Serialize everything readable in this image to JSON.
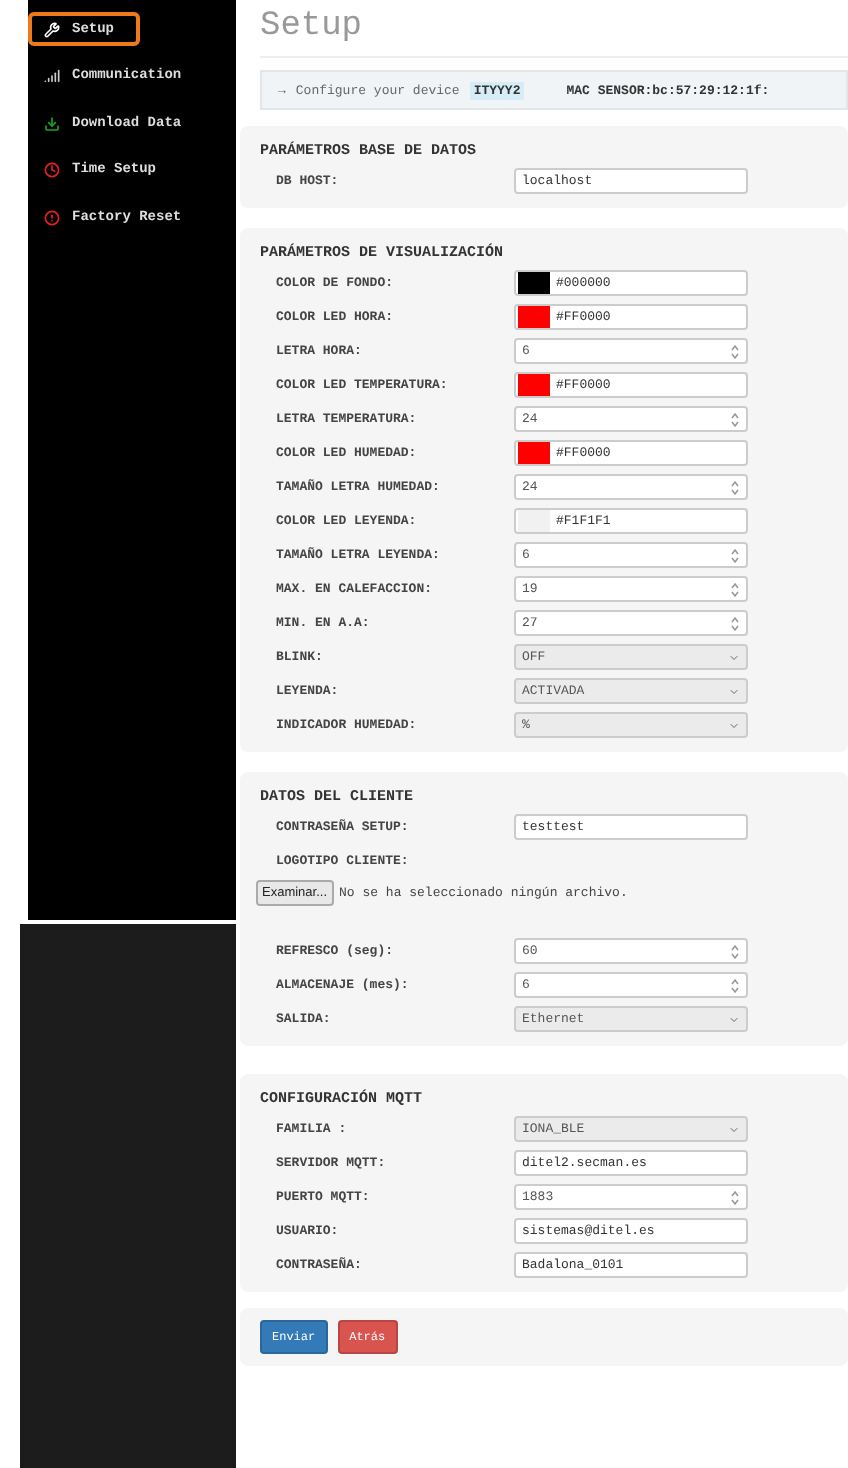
{
  "sidebar": {
    "items": [
      {
        "label": "Setup",
        "kind": "setup",
        "selected": true
      },
      {
        "label": "Communication",
        "kind": "communication",
        "selected": false
      },
      {
        "label": "Download Data",
        "kind": "download",
        "selected": false
      },
      {
        "label": "Time Setup",
        "kind": "time",
        "selected": false
      },
      {
        "label": "Factory Reset",
        "kind": "reset",
        "selected": false
      }
    ]
  },
  "page_title": "Setup",
  "info": {
    "arrow": "→",
    "text": "Configure your device",
    "device": "ITYYY2",
    "mac": "MAC SENSOR:bc:57:29:12:1f:"
  },
  "sections": [
    {
      "title": "PARÁMETROS BASE DE DATOS",
      "fields": [
        {
          "kind": "text",
          "label": "DB HOST:",
          "value": "localhost"
        }
      ]
    },
    {
      "title": "PARÁMETROS DE VISUALIZACIÓN",
      "fields": [
        {
          "kind": "color",
          "label": "COLOR DE FONDO:",
          "value": "#000000"
        },
        {
          "kind": "color",
          "label": "COLOR LED HORA:",
          "value": "#FF0000"
        },
        {
          "kind": "number",
          "label": "LETRA HORA:",
          "value": "6"
        },
        {
          "kind": "color",
          "label": "COLOR LED TEMPERATURA:",
          "value": "#FF0000"
        },
        {
          "kind": "number",
          "label": "LETRA TEMPERATURA:",
          "value": "24"
        },
        {
          "kind": "color",
          "label": "COLOR LED HUMEDAD:",
          "value": "#FF0000"
        },
        {
          "kind": "number",
          "label": "TAMAÑO LETRA HUMEDAD:",
          "value": "24"
        },
        {
          "kind": "color",
          "label": "COLOR LED LEYENDA:",
          "value": "#F1F1F1"
        },
        {
          "kind": "number",
          "label": "TAMAÑO LETRA LEYENDA:",
          "value": "6"
        },
        {
          "kind": "number",
          "label": "MAX. EN CALEFACCION:",
          "value": "19"
        },
        {
          "kind": "number",
          "label": "MIN. EN A.A:",
          "value": "27"
        },
        {
          "kind": "select",
          "label": "BLINK:",
          "value": "OFF"
        },
        {
          "kind": "select",
          "label": "LEYENDA:",
          "value": "ACTIVADA"
        },
        {
          "kind": "select",
          "label": "INDICADOR HUMEDAD:",
          "value": "%"
        }
      ]
    },
    {
      "title": "DATOS DEL CLIENTE",
      "fields": [
        {
          "kind": "text",
          "label": "CONTRASEÑA SETUP:",
          "value": "testtest"
        },
        {
          "kind": "file",
          "label": "LOGOTIPO CLIENTE:",
          "button": "Examinar...",
          "status": "No se ha seleccionado ningún archivo."
        },
        {
          "kind": "number",
          "label": "REFRESCO (seg):",
          "value": "60"
        },
        {
          "kind": "number",
          "label": "ALMACENAJE (mes):",
          "value": "6"
        },
        {
          "kind": "select",
          "label": "SALIDA:",
          "value": "Ethernet"
        }
      ]
    },
    {
      "title": "CONFIGURACIÓN MQTT",
      "fields": [
        {
          "kind": "select",
          "label": "FAMILIA :",
          "value": "IONA_BLE"
        },
        {
          "kind": "text",
          "label": "SERVIDOR MQTT:",
          "value": "ditel2.secman.es"
        },
        {
          "kind": "number",
          "label": "PUERTO MQTT:",
          "value": "1883"
        },
        {
          "kind": "text",
          "label": "USUARIO:",
          "value": "sistemas@ditel.es"
        },
        {
          "kind": "text",
          "label": "CONTRASEÑA:",
          "value": "Badalona_0101"
        }
      ]
    }
  ],
  "buttons": [
    {
      "label": "Enviar",
      "kind": "primary"
    },
    {
      "label": "Atrás",
      "kind": "danger"
    }
  ]
}
